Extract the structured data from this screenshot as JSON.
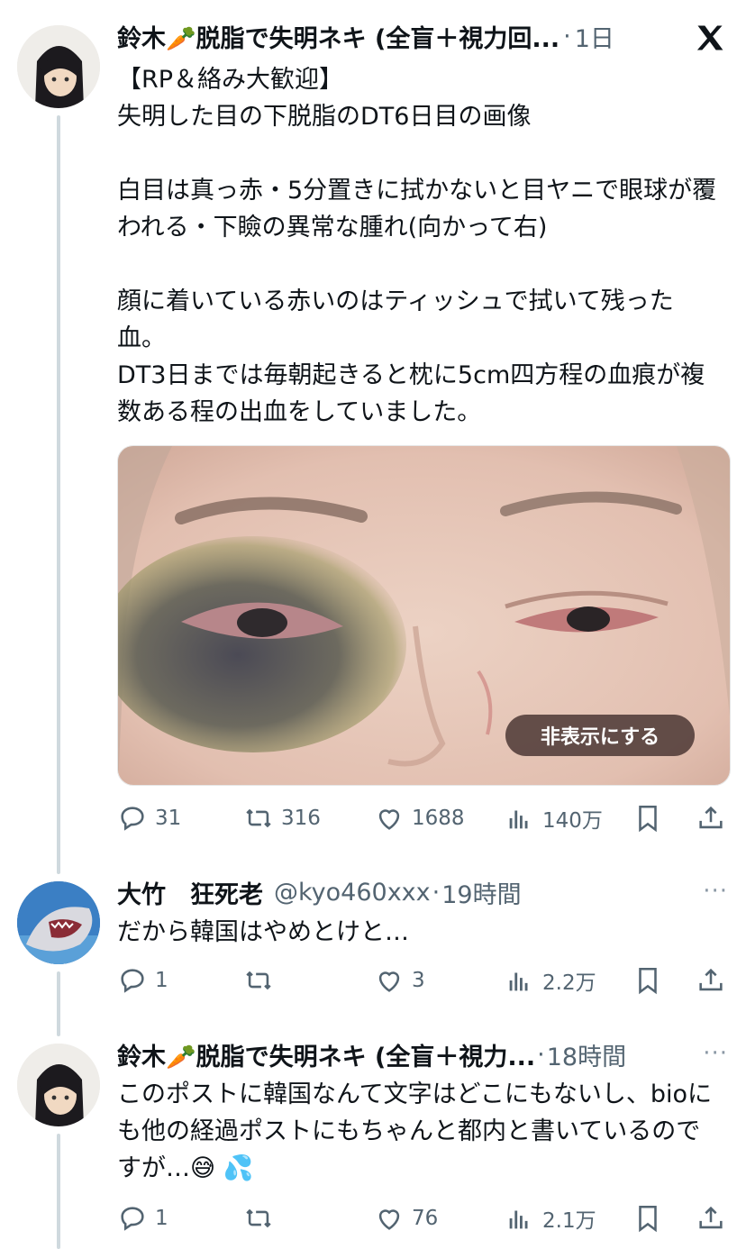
{
  "post1": {
    "author_name": "鈴木🥕脱脂で失明ネキ (全盲＋視力回...",
    "separator": "·",
    "time": "1日",
    "body": "【RP＆絡み大歓迎】\n失明した目の下脱脂のDT6日目の画像\n\n白目は真っ赤・5分置きに拭かないと目ヤニで眼球が覆われる・下瞼の異常な腫れ(向かって右)\n\n顔に着いている赤いのはティッシュで拭いて残った血。\nDT3日までは毎朝起きると枕に5cm四方程の血痕が複数ある程の出血をしていました。",
    "image_button": "非表示にする",
    "replies": "31",
    "reposts": "316",
    "likes": "1688",
    "views": "140万"
  },
  "post2": {
    "author_name": "大竹　狂死老",
    "handle": "@kyo460xxx",
    "separator": "·",
    "time": "19時間",
    "body": "だから韓国はやめとけと…",
    "replies": "1",
    "reposts": "",
    "likes": "3",
    "views": "2.2万",
    "more": "···"
  },
  "post3": {
    "author_name": "鈴木🥕脱脂で失明ネキ (全盲＋視力...",
    "separator": "·",
    "time": "18時間",
    "body": "このポストに韓国なんて文字はどこにもないし、bioにも他の経過ポストにもちゃんと都内と書いているのですが…😅 💦",
    "replies": "1",
    "reposts": "",
    "likes": "76",
    "views": "2.1万",
    "more": "···"
  },
  "icons": {
    "x_logo": "x-logo-icon",
    "reply": "reply-icon",
    "repost": "repost-icon",
    "like": "like-icon",
    "views": "views-icon",
    "bookmark": "bookmark-icon",
    "share": "share-icon"
  },
  "colors": {
    "text": "#0f1419",
    "muted": "#536471",
    "thread_line": "#cfd9de"
  }
}
